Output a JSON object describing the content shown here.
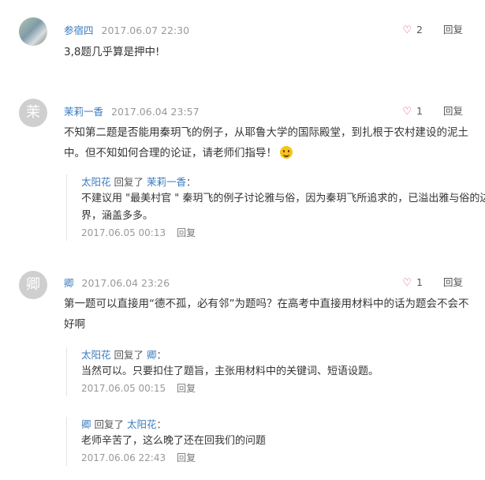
{
  "comments": [
    {
      "avatar_char": "",
      "username": "参宿四",
      "time": "2017.06.07 22:30",
      "likes": "2",
      "reply_label": "回复",
      "text": "3,8题几乎算是押中!"
    },
    {
      "avatar_char": "茉",
      "username": "茉莉一香",
      "time": "2017.06.04 23:57",
      "likes": "1",
      "reply_label": "回复",
      "text": "不知第二题是否能用秦玥飞的例子，从耶鲁大学的国际殿堂，到扎根于农村建设的泥土中。但不知如何合理的论证，请老师们指导！",
      "replies": [
        {
          "from": "太阳花",
          "replied_label": "回复了",
          "to": "茉莉一香",
          "text": "不建议用 \"最美村官 \" 秦玥飞的例子讨论雅与俗，因为秦玥飞所追求的，已溢出雅与俗的边界，涵盖多多。",
          "time": "2017.06.05 00:13",
          "reply_label": "回复"
        }
      ]
    },
    {
      "avatar_char": "卿",
      "username": "卿",
      "time": "2017.06.04 23:26",
      "likes": "1",
      "reply_label": "回复",
      "text": "第一题可以直接用“德不孤，必有邻”为题吗？在高考中直接用材料中的话为题会不会不好啊",
      "replies": [
        {
          "from": "太阳花",
          "replied_label": "回复了",
          "to": "卿",
          "text": "当然可以。只要扣住了题旨，主张用材料中的关键词、短语设题。",
          "time": "2017.06.05 00:15",
          "reply_label": "回复"
        },
        {
          "from": "卿",
          "replied_label": "回复了",
          "to": "太阳花",
          "text": "老师辛苦了，这么晚了还在回我们的问题",
          "time": "2017.06.06 22:43",
          "reply_label": "回复"
        }
      ]
    }
  ],
  "icons": {
    "like": "heart-icon",
    "emoji": "smile-emoji-icon"
  },
  "colors": {
    "username": "#3a7bbf",
    "heart": "#e0405a",
    "muted": "#999999"
  }
}
